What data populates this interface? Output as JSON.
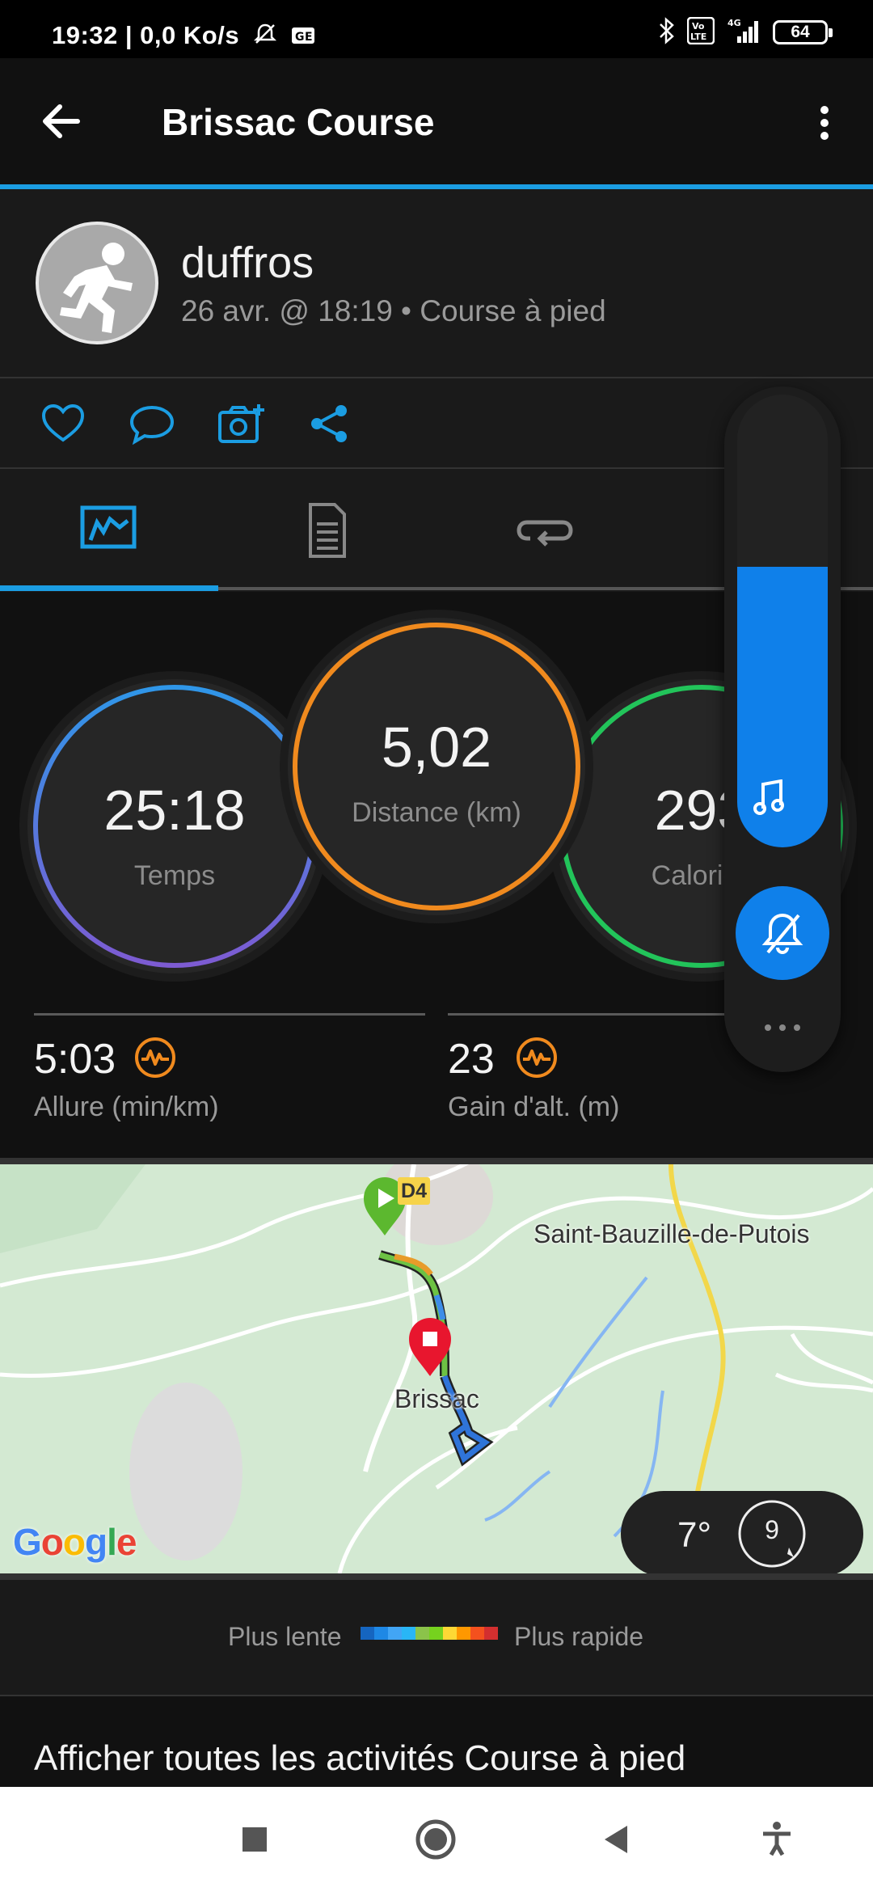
{
  "status_bar": {
    "time_speed": "19:32 | 0,0 Ko/s",
    "battery": "64",
    "network": "4G",
    "volte": "Vo LTE"
  },
  "app_bar": {
    "title": "Brissac Course"
  },
  "profile": {
    "username": "duffros",
    "subline": "26 avr. @ 18:19 • Course à pied"
  },
  "action_icons": [
    "heart-icon",
    "comment-icon",
    "camera-add-icon",
    "share-icon"
  ],
  "tabs": [
    "stats-tab-icon",
    "details-tab-icon",
    "laps-tab-icon"
  ],
  "stats": {
    "time": {
      "value": "25:18",
      "label": "Temps"
    },
    "distance": {
      "value": "5,02",
      "label": "Distance (km)"
    },
    "calories": {
      "value": "293",
      "label": "Calories"
    },
    "pace": {
      "value": "5:03",
      "label": "Allure (min/km)"
    },
    "elevation": {
      "value": "23",
      "label": "Gain d'alt. (m)"
    }
  },
  "volume_panel": {
    "level": 0.62
  },
  "map": {
    "road": "D4",
    "town_1": "Saint-Bauzille-de-Putois",
    "town_2": "Brissac",
    "google": "Google",
    "temperature": "7°",
    "wind": "9"
  },
  "legend": {
    "slow": "Plus lente",
    "fast": "Plus rapide",
    "colors": [
      "#1565c0",
      "#1e88e5",
      "#42a5f5",
      "#29b6f6",
      "#8bc34a",
      "#76d21e",
      "#fdd835",
      "#ff9800",
      "#f4511e",
      "#d32f2f"
    ]
  },
  "footer": {
    "all_activities": "Afficher toutes les activités Course à pied"
  },
  "colors": {
    "accent": "#1b9de2",
    "time_ring": "#3a8ee0",
    "distance_ring": "#f08a1e",
    "calories_ring": "#22c45a"
  }
}
